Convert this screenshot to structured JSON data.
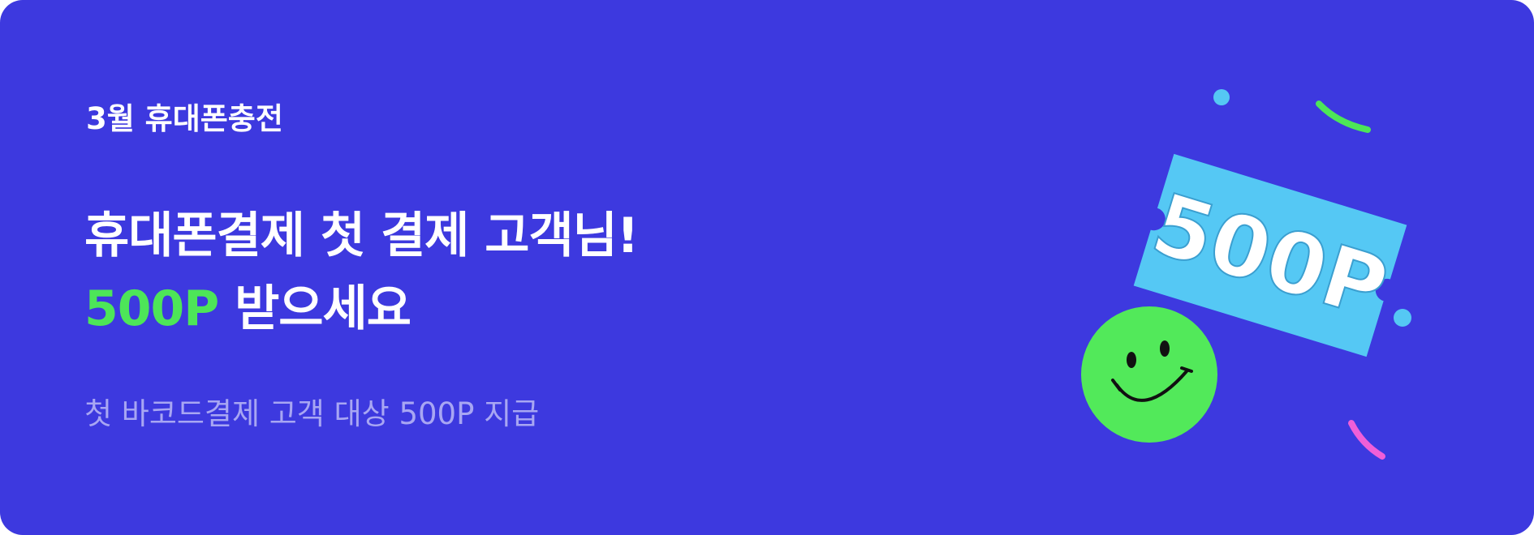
{
  "banner": {
    "eyebrow": "3월 휴대폰충전",
    "headline_line1": "휴대폰결제 첫 결제 고객님!",
    "headline_accent": "500P",
    "headline_rest": "받으세요",
    "subtitle": "첫 바코드결제 고객 대상 500P 지급",
    "ticket_text": "500P"
  },
  "colors": {
    "background": "#3d39df",
    "accent_green": "#4de658",
    "ticket_blue": "#55c8f4",
    "smiley_green": "#52e95a",
    "confetti_pink": "#f05fd8",
    "subtitle": "#a8a6f3"
  },
  "icons": {
    "illustration": "ticket-icon",
    "smiley": "smiley-face-icon"
  }
}
